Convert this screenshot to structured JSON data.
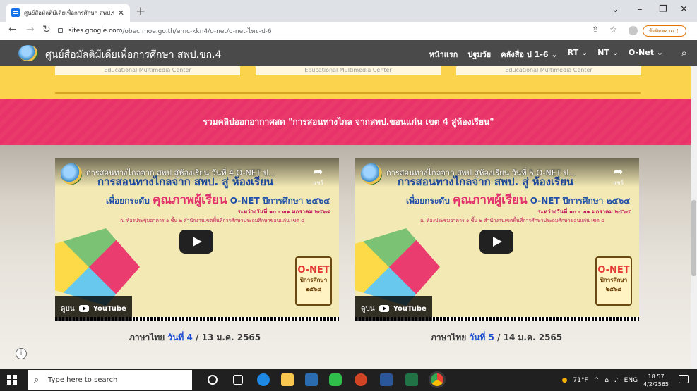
{
  "browser": {
    "tab_title": "ศูนย์สื่อมัลติมีเดียเพื่อการศึกษา สพป.ข",
    "url_domain": "sites.google.com",
    "url_path": "/obec.moe.go.th/emc-kkn4/o-net/o-net-ไทย-ป-6",
    "update_label": "ข้อผิดพลาด"
  },
  "site": {
    "title": "ศูนย์สื่อมัลติมีเดียเพื่อการศึกษา สพป.ขก.4",
    "nav": [
      "หน้าแรก",
      "ปฐมวัย",
      "คลังสื่อ ป 1-6",
      "RT",
      "NT",
      "O-Net"
    ],
    "emc_label": "Educational Multimedia Center",
    "banner": "รวมคลิปออกอากาศสด \"การสอนทางไกล จากสพป.ขอนแก่น เขต 4 สู่ห้องเรียน\""
  },
  "videos": [
    {
      "title": "การสอนทางไกลจาก สพป.สู่ห้องเรียน วันที่ 4 O-NET ป...",
      "share": "แชร์",
      "heading": "การสอนทางไกลจาก สพป. สู่ ห้องเรียน",
      "line_a": "เพื่อยกระดับ",
      "line_b": "คุณภาพผู้เรียน",
      "line_c": "O-NET ปีการศึกษา ๒๕๖๔",
      "dates": "ระหว่างวันที่ ๑๐ - ๓๑ มกราคม ๒๕๖๕",
      "venue": "ณ ห้องประชุมอาคาร ๑ ชั้น ๒ สำนักงานเขตพื้นที่การศึกษาประถมศึกษาขอนแก่น เขต ๔",
      "badge_top": "O-NET",
      "badge_mid": "ปีการศึกษา",
      "badge_year": "๒๕๖๔",
      "watch_on": "ดูบน",
      "yt": "YouTube",
      "caption_pre": "ภาษาไทย",
      "caption_hl": "วันที่ 4",
      "caption_post": "/ 13 ม.ค. 2565"
    },
    {
      "title": "การสอนทางไกลจาก สพป.สู่ห้องเรียน วันที่ 5 O-NET ป...",
      "share": "แชร์",
      "heading": "การสอนทางไกลจาก สพป. สู่ ห้องเรียน",
      "line_a": "เพื่อยกระดับ",
      "line_b": "คุณภาพผู้เรียน",
      "line_c": "O-NET ปีการศึกษา ๒๕๖๔",
      "dates": "ระหว่างวันที่ ๑๐ - ๓๑ มกราคม ๒๕๖๕",
      "venue": "ณ ห้องประชุมอาคาร ๑ ชั้น ๒ สำนักงานเขตพื้นที่การศึกษาประถมศึกษาขอนแก่น เขต ๔",
      "badge_top": "O-NET",
      "badge_mid": "ปีการศึกษา",
      "badge_year": "๒๕๖๔",
      "watch_on": "ดูบน",
      "yt": "YouTube",
      "caption_pre": "ภาษาไทย",
      "caption_hl": "วันที่ 5",
      "caption_post": "/ 14 ม.ค. 2565"
    }
  ],
  "taskbar": {
    "search_placeholder": "Type here to search",
    "weather": "71°F",
    "lang": "ENG",
    "time": "18:57",
    "date": "4/2/2565"
  },
  "colors": {
    "header": "#4a4a4a",
    "yellow": "#fcd34d",
    "pink": "#e8336a",
    "highlight": "#1a4fd0"
  }
}
